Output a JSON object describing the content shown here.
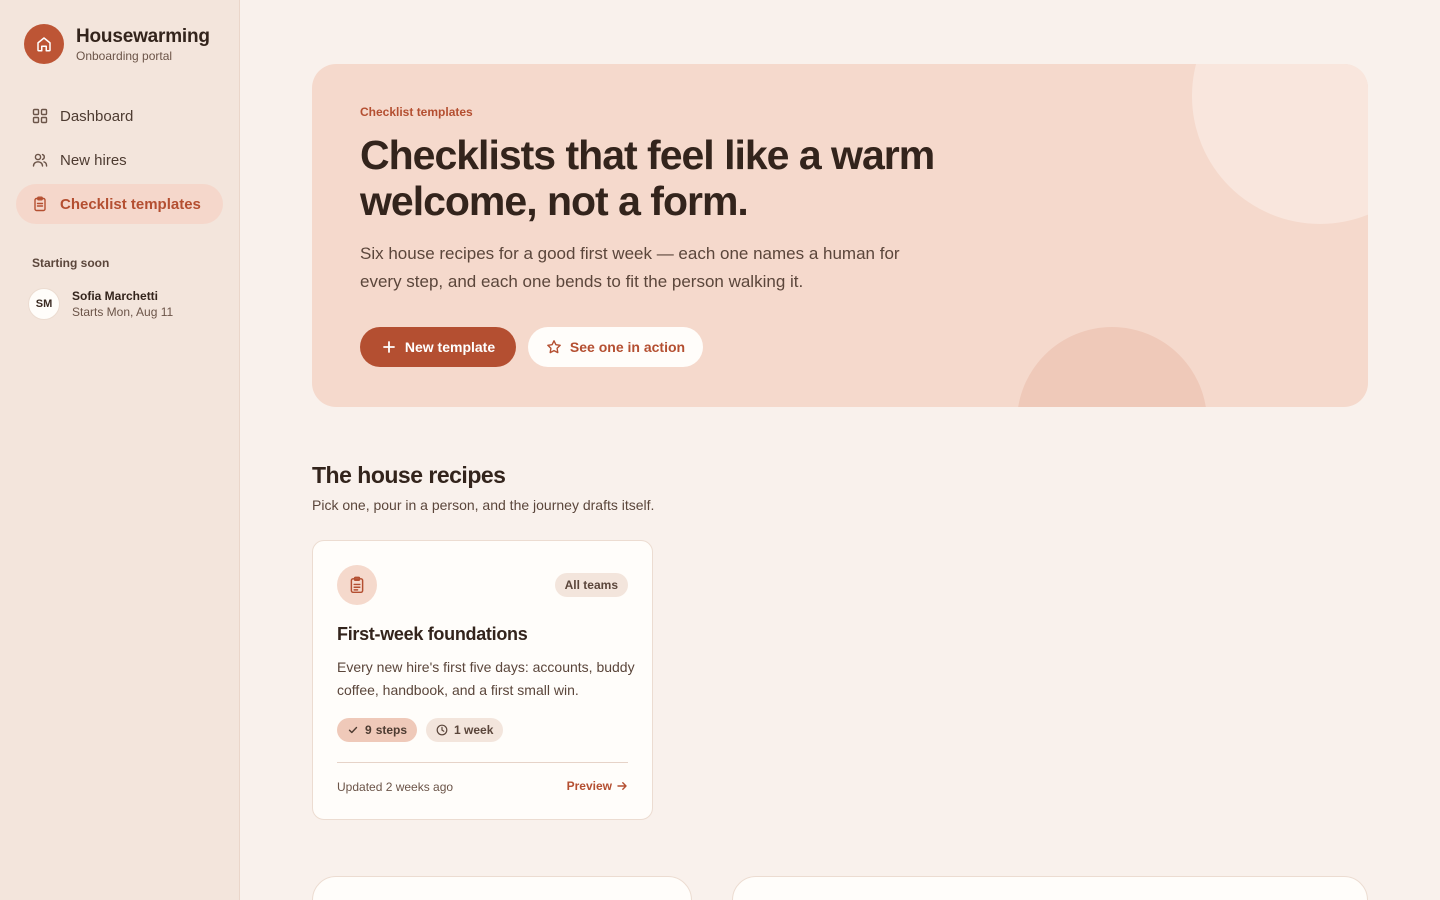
{
  "brand": {
    "name": "Housewarming",
    "subtitle": "Onboarding portal"
  },
  "nav": [
    {
      "label": "Dashboard",
      "icon": "grid-icon",
      "active": false
    },
    {
      "label": "New hires",
      "icon": "users-icon",
      "active": false
    },
    {
      "label": "Checklist templates",
      "icon": "clipboard-icon",
      "active": true
    }
  ],
  "starting_soon": {
    "label": "Starting soon",
    "people": [
      {
        "initials": "SM",
        "name": "Sofia Marchetti",
        "start": "Starts Mon, Aug 11"
      }
    ]
  },
  "hero": {
    "eyebrow": "Checklist templates",
    "title": "Checklists that feel like a warm welcome, not a form.",
    "subtitle": "Six house recipes for a good first week — each one names a human for every step, and each one bends to fit the person walking it.",
    "primary_label": "New template",
    "secondary_label": "See one in action"
  },
  "section": {
    "title": "The house recipes",
    "subtitle": "Pick one, pour in a person, and the journey drafts itself."
  },
  "cards": [
    {
      "icon": "clipboard-icon",
      "badge": "All teams",
      "title": "First-week foundations",
      "description": "Every new hire's first five days: accounts, buddy coffee, handbook, and a first small win.",
      "steps_count": "9",
      "steps_label": "steps",
      "duration": "1 week",
      "updated": "Updated 2 weeks ago",
      "preview_label": "Preview"
    }
  ],
  "colors": {
    "accent": "#b44f31",
    "hero_bg": "#f5d9cc",
    "page_bg": "#f9f1ec",
    "sidebar_bg": "#f3e5dc"
  }
}
